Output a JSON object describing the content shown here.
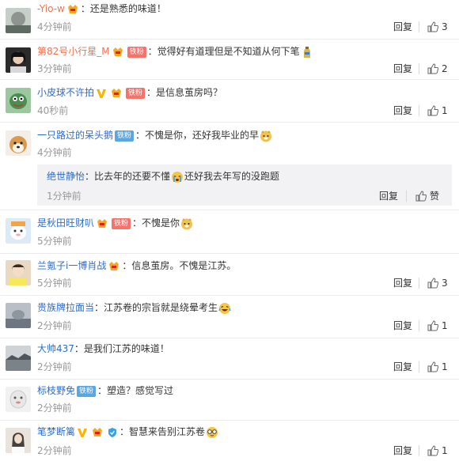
{
  "comments": [
    {
      "user": "-Yio-w",
      "badges": [
        "vip"
      ],
      "fan": "",
      "text": "：还是熟悉的味道！",
      "emoji": [],
      "time": "4分钟前",
      "likes": "3"
    },
    {
      "user": "第82号小行星_M",
      "badges": [
        "vip"
      ],
      "fan": "铁粉",
      "text": "：觉得好有道理但是不知道从何下笔",
      "emoji": [
        "bottle"
      ],
      "time": "3分钟前",
      "likes": "2"
    },
    {
      "user": "小皮球不许拍",
      "badges": [
        "v",
        "vip"
      ],
      "fan": "铁粉",
      "text": "：是信息茧房吗？",
      "emoji": [],
      "time": "40秒前",
      "likes": "1"
    },
    {
      "user": "一只路过的呆头鹅",
      "badges": [],
      "fan": "铁粉",
      "text": "：不愧是你，还好我毕业的早",
      "emoji": [
        "doge"
      ],
      "time": "4分钟前",
      "likes": ""
    },
    {
      "user": "是秋田旺财叭",
      "badges": [
        "vip"
      ],
      "fan": "铁粉",
      "text": "：不愧是你",
      "emoji": [
        "doge"
      ],
      "time": "5分钟前",
      "likes": ""
    },
    {
      "user": "兰氪子i一博肖战",
      "badges": [
        "vip"
      ],
      "fan": "",
      "text": "：信息茧房。不愧是江苏。",
      "emoji": [],
      "time": "5分钟前",
      "likes": "3"
    },
    {
      "user": "贵族牌拉面当",
      "badges": [],
      "fan": "",
      "text": "：江苏卷的宗旨就是绕晕考生",
      "emoji": [
        "laugh"
      ],
      "time": "2分钟前",
      "likes": "1"
    },
    {
      "user": "大帅437",
      "badges": [],
      "fan": "",
      "text": "：是我们江苏的味道！",
      "emoji": [],
      "time": "2分钟前",
      "likes": "1"
    },
    {
      "user": "标枝野免",
      "badges": [],
      "fan": "铁粉",
      "text": "：塑造？感觉写过",
      "emoji": [],
      "time": "2分钟前",
      "likes": ""
    },
    {
      "user": "笔梦断篱",
      "badges": [
        "v",
        "vip",
        "shield"
      ],
      "fan": "",
      "text": "：智慧来告别江苏卷",
      "emoji": [
        "glasses"
      ],
      "time": "2分钟前",
      "likes": "1"
    }
  ],
  "subreply": {
    "user": "绝世静怡",
    "text": "：比去年的还要不懂",
    "text2": "还好我去年写的没跑题",
    "time": "1分钟前",
    "like_label": "赞"
  },
  "labels": {
    "reply": "回复"
  },
  "colors": {
    "username": "#eb7350",
    "link": "#2e6cc7"
  }
}
